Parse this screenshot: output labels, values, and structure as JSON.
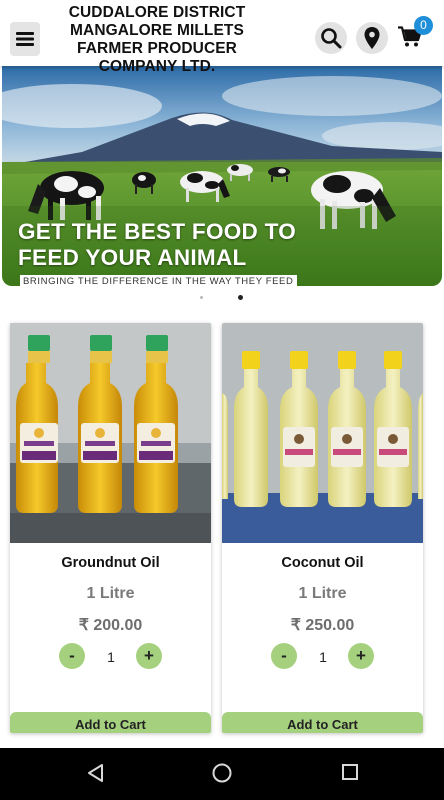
{
  "header": {
    "brand": "CUDDALORE DISTRICT MANGALORE MILLETS FARMER PRODUCER COMPANY LTD.",
    "menu_icon": "hamburger-icon",
    "search_icon": "search-icon",
    "location_icon": "location-pin-icon",
    "cart_icon": "shopping-cart-icon",
    "cart_count": "0"
  },
  "banner": {
    "title": "GET THE BEST FOOD TO FEED YOUR ANIMAL",
    "subtitle": "BRINGING THE DIFFERENCE IN THE WAY THEY FEED",
    "slide_count": 2,
    "active_slide": 2
  },
  "products": [
    {
      "name": "Groundnut Oil",
      "quantity": "1 Litre",
      "price": "₹ 200.00",
      "count": "1",
      "minus": "-",
      "plus": "+",
      "add_label": "Add to Cart",
      "bottle_cap_color": "#2fa35c",
      "bottle_label": "MARRABU"
    },
    {
      "name": "Coconut Oil",
      "quantity": "1 Litre",
      "price": "₹ 250.00",
      "count": "1",
      "minus": "-",
      "plus": "+",
      "add_label": "Add to Cart",
      "bottle_cap_color": "#f2d21b",
      "bottle_label": ""
    }
  ],
  "colors": {
    "accent_green": "#a5d17f",
    "badge_blue": "#1e8fd8"
  },
  "system_nav": {
    "back_icon": "back-triangle-icon",
    "home_icon": "home-circle-icon",
    "recents_icon": "recents-square-icon"
  }
}
